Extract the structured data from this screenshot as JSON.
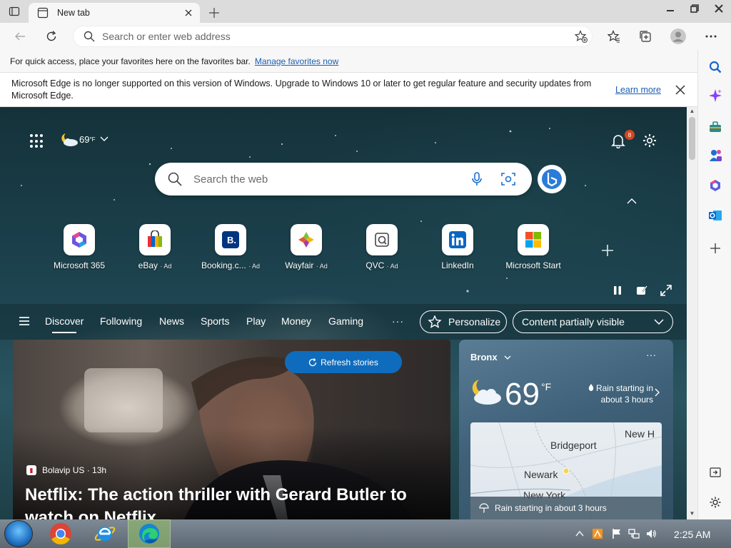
{
  "window": {
    "tab_title": "New tab",
    "new_tab_label": "+"
  },
  "toolbar": {
    "address_placeholder": "Search or enter web address"
  },
  "favorites_bar": {
    "text": "For quick access, place your favorites here on the favorites bar.",
    "link": "Manage favorites now"
  },
  "notification_bar": {
    "message": "Microsoft Edge is no longer supported on this version of Windows. Upgrade to Windows 10 or later to get regular feature and security updates from Microsoft Edge.",
    "link": "Learn more"
  },
  "ntp": {
    "weather_temp": "69",
    "weather_unit": "°F",
    "notification_count": "8",
    "search_placeholder": "Search the web",
    "tiles": [
      {
        "label": "Microsoft 365",
        "ad": ""
      },
      {
        "label": "eBay",
        "ad": "· Ad"
      },
      {
        "label": "Booking.c...",
        "ad": "· Ad"
      },
      {
        "label": "Wayfair",
        "ad": "· Ad"
      },
      {
        "label": "QVC",
        "ad": "· Ad"
      },
      {
        "label": "LinkedIn",
        "ad": ""
      },
      {
        "label": "Microsoft Start",
        "ad": ""
      }
    ]
  },
  "feed_nav": {
    "items": [
      "Discover",
      "Following",
      "News",
      "Sports",
      "Play",
      "Money",
      "Gaming"
    ],
    "more": "···",
    "personalize": "Personalize",
    "visibility": "Content partially visible"
  },
  "hero": {
    "refresh_label": "Refresh stories",
    "source": "Bolavip US · 13h",
    "headline": "Netflix: The action thriller with Gerard Butler to watch on Netflix"
  },
  "weather_card": {
    "location": "Bronx",
    "temp": "69",
    "unit": "°F",
    "rain_text": "Rain starting in about 3 hours",
    "map_labels": [
      "New H",
      "Bridgeport",
      "Newark",
      "New York"
    ],
    "map_footer": "Rain starting in about 3 hours"
  },
  "taskbar": {
    "clock": "2:25 AM"
  }
}
